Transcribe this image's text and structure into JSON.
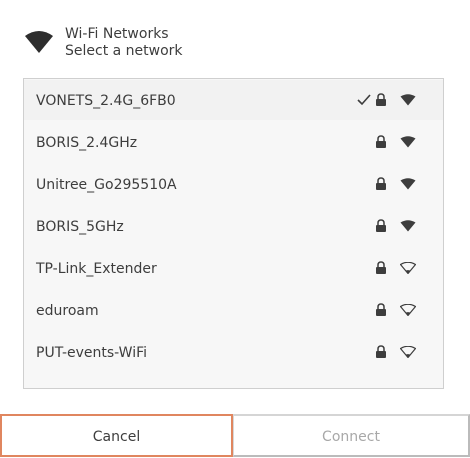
{
  "header": {
    "title": "Wi-Fi Networks",
    "subtitle": "Select a network",
    "icon": "wifi-icon"
  },
  "networks": [
    {
      "ssid": "VONETS_2.4G_6FB0",
      "connected": true,
      "secured": true,
      "signal": "strong"
    },
    {
      "ssid": "BORIS_2.4GHz",
      "connected": false,
      "secured": true,
      "signal": "strong"
    },
    {
      "ssid": "Unitree_Go295510A",
      "connected": false,
      "secured": true,
      "signal": "strong"
    },
    {
      "ssid": "BORIS_5GHz",
      "connected": false,
      "secured": true,
      "signal": "strong"
    },
    {
      "ssid": "TP-Link_Extender",
      "connected": false,
      "secured": true,
      "signal": "weak"
    },
    {
      "ssid": "eduroam",
      "connected": false,
      "secured": true,
      "signal": "weak"
    },
    {
      "ssid": "PUT-events-WiFi",
      "connected": false,
      "secured": true,
      "signal": "weak"
    }
  ],
  "buttons": {
    "cancel_label": "Cancel",
    "connect_label": "Connect"
  },
  "colors": {
    "focus_border": "#e0865f",
    "disabled_text": "#a8a8a8",
    "text": "#3d3d3d"
  }
}
